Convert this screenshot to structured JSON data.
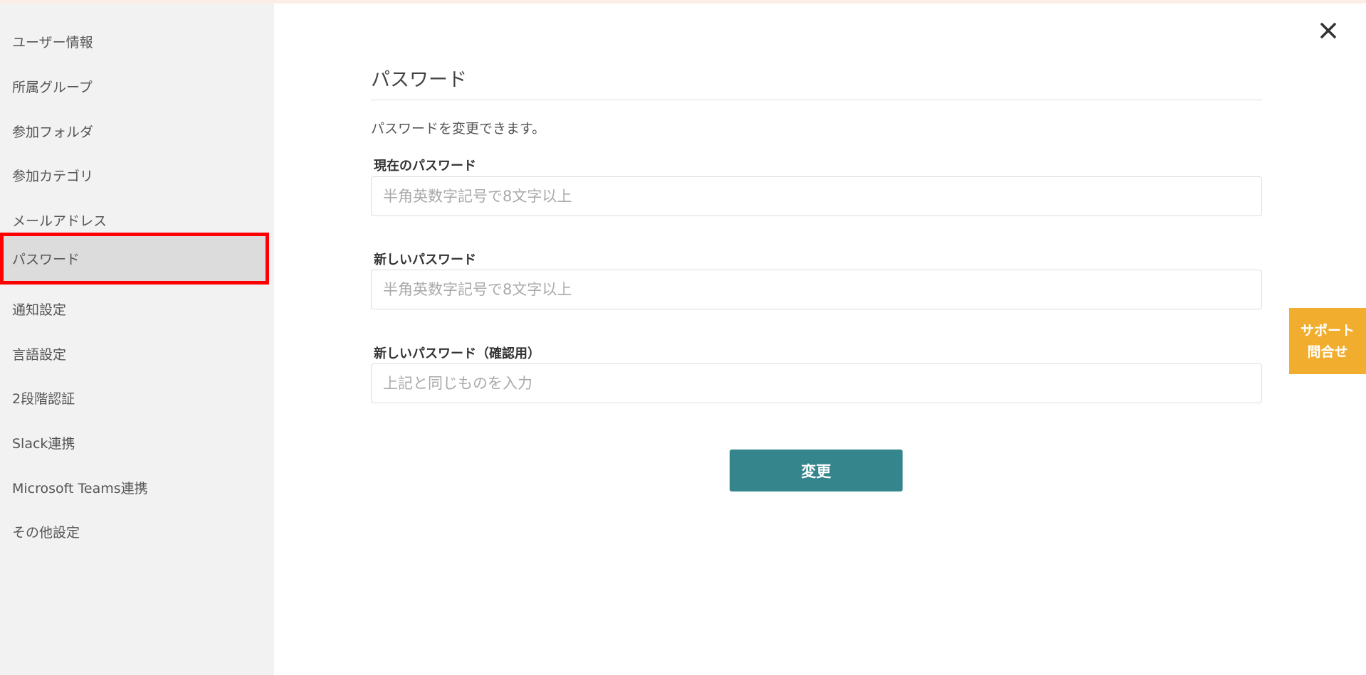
{
  "sidebar": {
    "items": [
      {
        "label": "ユーザー情報"
      },
      {
        "label": "所属グループ"
      },
      {
        "label": "参加フォルダ"
      },
      {
        "label": "参加カテゴリ"
      },
      {
        "label": "メールアドレス"
      },
      {
        "label": "パスワード",
        "active": true
      },
      {
        "label": "通知設定"
      },
      {
        "label": "言語設定"
      },
      {
        "label": "2段階認証"
      },
      {
        "label": "Slack連携"
      },
      {
        "label": "Microsoft Teams連携"
      },
      {
        "label": "その他設定"
      }
    ]
  },
  "main": {
    "title": "パスワード",
    "description": "パスワードを変更できます。",
    "fields": [
      {
        "label": "現在のパスワード",
        "placeholder": "半角英数字記号で8文字以上",
        "value": ""
      },
      {
        "label": "新しいパスワード",
        "placeholder": "半角英数字記号で8文字以上",
        "value": ""
      },
      {
        "label": "新しいパスワード（確認用）",
        "placeholder": "上記と同じものを入力",
        "value": ""
      }
    ],
    "submit_label": "変更"
  },
  "support": {
    "line1": "サポート",
    "line2": "問合せ"
  },
  "colors": {
    "sidebar_bg": "#f2f2f2",
    "active_item_bg": "#dcdcdc",
    "highlight_border": "#ff0000",
    "submit_button": "#35858d",
    "support_tab": "#f0ad2e"
  },
  "icons": {
    "close": "close-icon"
  }
}
